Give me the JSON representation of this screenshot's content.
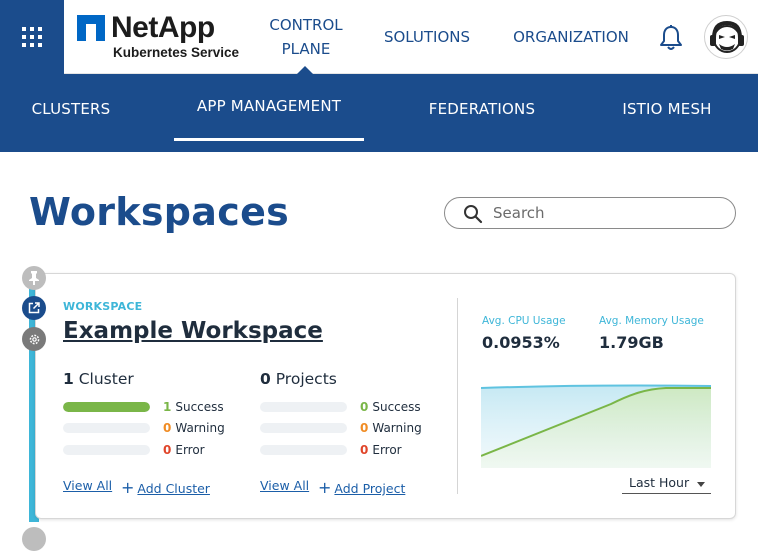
{
  "header": {
    "brand": "NetApp",
    "product": "Kubernetes Service",
    "nav": [
      {
        "label": "CONTROL PLANE",
        "active": true
      },
      {
        "label": "SOLUTIONS"
      },
      {
        "label": "ORGANIZATION"
      }
    ],
    "icons": [
      "apps-grid-icon",
      "bell-icon",
      "avatar"
    ]
  },
  "subnav": {
    "tabs": [
      {
        "label": "CLUSTERS"
      },
      {
        "label": "APP MANAGEMENT",
        "active": true
      },
      {
        "label": "FEDERATIONS"
      },
      {
        "label": "ISTIO MESH"
      }
    ]
  },
  "page": {
    "title": "Workspaces",
    "search_placeholder": "Search"
  },
  "workspace": {
    "kicker": "WORKSPACE",
    "name": "Example Workspace",
    "clusters": {
      "count": "1",
      "label": "Cluster",
      "success": "1",
      "warning": "0",
      "error": "0",
      "success_fraction": 1.0,
      "view_all": "View All",
      "add": "Add Cluster"
    },
    "projects": {
      "count": "0",
      "label": "Projects",
      "success": "0",
      "warning": "0",
      "error": "0",
      "success_fraction": 0.0,
      "view_all": "View All",
      "add": "Add Project"
    },
    "status_labels": {
      "success": "Success",
      "warning": "Warning",
      "error": "Error"
    },
    "metrics": {
      "cpu_label": "Avg. CPU Usage",
      "cpu_value": "0.0953%",
      "mem_label": "Avg. Memory Usage",
      "mem_value": "1.79GB"
    },
    "time_range": "Last Hour"
  },
  "colors": {
    "primary": "#1b4c8c",
    "accent": "#3eb6d8",
    "success": "#7ab648",
    "warning": "#f08c24",
    "error": "#e0452a"
  }
}
